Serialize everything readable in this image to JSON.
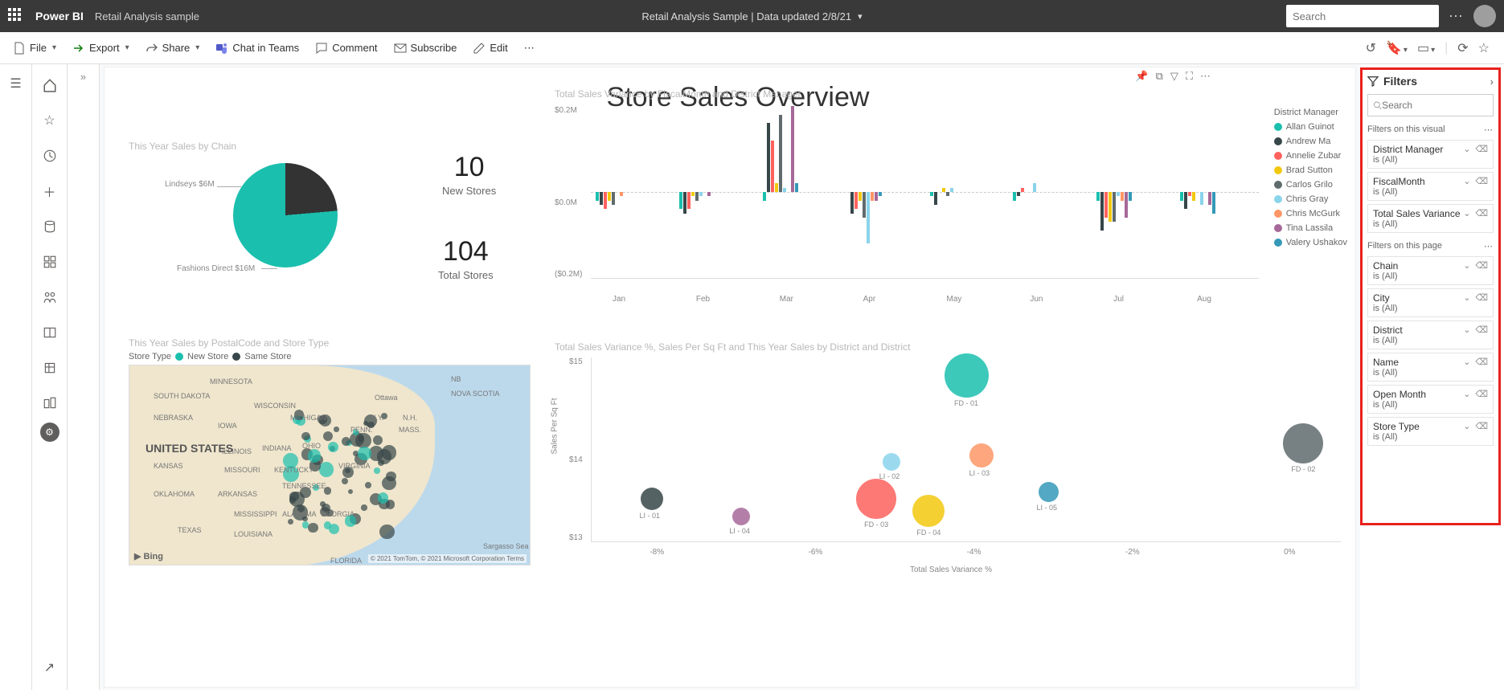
{
  "header": {
    "brand": "Power BI",
    "subtitle": "Retail Analysis sample",
    "center": "Retail Analysis Sample  |  Data updated 2/8/21",
    "search_placeholder": "Search"
  },
  "commands": {
    "file": "File",
    "export": "Export",
    "share": "Share",
    "chat_in_teams": "Chat in Teams",
    "comment": "Comment",
    "subscribe": "Subscribe",
    "edit": "Edit"
  },
  "report": {
    "title": "Store Sales Overview",
    "viz_pie_title": "This Year Sales by Chain",
    "pie_label_a": "Lindseys $6M",
    "pie_label_b": "Fashions Direct $16M",
    "kpi1_val": "10",
    "kpi1_lbl": "New Stores",
    "kpi2_val": "104",
    "kpi2_lbl": "Total Stores",
    "viz_bar_title": "Total Sales Variance by FiscalMonth and District Manager",
    "legend_title": "District Manager",
    "legend_items": [
      {
        "name": "Allan Guinot",
        "color": "#1bbfae"
      },
      {
        "name": "Andrew Ma",
        "color": "#374649"
      },
      {
        "name": "Annelie Zubar",
        "color": "#fd625e"
      },
      {
        "name": "Brad Sutton",
        "color": "#f2c80f"
      },
      {
        "name": "Carlos Grilo",
        "color": "#5f6b6d"
      },
      {
        "name": "Chris Gray",
        "color": "#8ad4eb"
      },
      {
        "name": "Chris McGurk",
        "color": "#fe9666"
      },
      {
        "name": "Tina Lassila",
        "color": "#a66999"
      },
      {
        "name": "Valery Ushakov",
        "color": "#3599b8"
      }
    ],
    "bar_y_top": "$0.2M",
    "bar_y_mid": "$0.0M",
    "bar_y_bot": "($0.2M)",
    "bar_x": [
      "Jan",
      "Feb",
      "Mar",
      "Apr",
      "May",
      "Jun",
      "Jul",
      "Aug"
    ],
    "viz_map_title": "This Year Sales by PostalCode and Store Type",
    "map_legend_label": "Store Type",
    "map_legend_a": "New Store",
    "map_legend_b": "Same Store",
    "map_country": "UNITED STATES",
    "map_bing": "▶ Bing",
    "map_attr": "© 2021 TomTom, © 2021 Microsoft Corporation  Terms",
    "viz_scatter_title": "Total Sales Variance %, Sales Per Sq Ft and This Year Sales by District and District",
    "scatter_y_label": "Sales Per Sq Ft",
    "scatter_x_label": "Total Sales Variance %",
    "scatter_y_ticks": [
      "$15",
      "$14",
      "$13"
    ],
    "scatter_x_ticks": [
      "-8%",
      "-6%",
      "-4%",
      "-2%",
      "0%"
    ],
    "scatter_points": [
      "FD - 01",
      "FD - 02",
      "LI - 03",
      "LI - 02",
      "FD - 03",
      "FD - 04",
      "LI - 05",
      "LI - 01",
      "LI - 04"
    ]
  },
  "filters": {
    "title": "Filters",
    "search_placeholder": "Search",
    "section_visual": "Filters on this visual",
    "section_page": "Filters on this page",
    "is_all": "is (All)",
    "visual_filters": [
      "District Manager",
      "FiscalMonth",
      "Total Sales Variance"
    ],
    "page_filters": [
      "Chain",
      "City",
      "District",
      "Name",
      "Open Month",
      "Store Type"
    ]
  },
  "chart_data": [
    {
      "type": "pie",
      "title": "This Year Sales by Chain",
      "series": [
        {
          "name": "Lindseys",
          "value": 6,
          "unit": "$M",
          "color": "#374649"
        },
        {
          "name": "Fashions Direct",
          "value": 16,
          "unit": "$M",
          "color": "#1bbfae"
        }
      ]
    },
    {
      "type": "bar",
      "title": "Total Sales Variance by FiscalMonth and District Manager",
      "ylabel": "Total Sales Variance",
      "ylim": [
        -0.2,
        0.2
      ],
      "yunit": "$M",
      "categories": [
        "Jan",
        "Feb",
        "Mar",
        "Apr",
        "May",
        "Jun",
        "Jul",
        "Aug"
      ],
      "series": [
        {
          "name": "Allan Guinot",
          "color": "#1bbfae",
          "values": [
            -0.02,
            -0.04,
            -0.02,
            0.0,
            -0.01,
            -0.02,
            -0.02,
            -0.02
          ]
        },
        {
          "name": "Andrew Ma",
          "color": "#374649",
          "values": [
            -0.03,
            -0.05,
            0.16,
            -0.05,
            -0.03,
            -0.01,
            -0.09,
            -0.04
          ]
        },
        {
          "name": "Annelie Zubar",
          "color": "#fd625e",
          "values": [
            -0.04,
            -0.04,
            0.12,
            -0.04,
            0.0,
            0.01,
            -0.06,
            -0.01
          ]
        },
        {
          "name": "Brad Sutton",
          "color": "#f2c80f",
          "values": [
            -0.02,
            -0.01,
            0.02,
            -0.02,
            0.01,
            0.0,
            -0.07,
            -0.02
          ]
        },
        {
          "name": "Carlos Grilo",
          "color": "#5f6b6d",
          "values": [
            -0.03,
            -0.02,
            0.18,
            -0.06,
            -0.01,
            0.0,
            -0.07,
            0.0
          ]
        },
        {
          "name": "Chris Gray",
          "color": "#8ad4eb",
          "values": [
            0.0,
            -0.01,
            0.01,
            -0.12,
            0.01,
            0.02,
            -0.01,
            -0.03
          ]
        },
        {
          "name": "Chris McGurk",
          "color": "#fe9666",
          "values": [
            -0.01,
            0.0,
            0.0,
            -0.02,
            0.0,
            0.0,
            -0.02,
            0.0
          ]
        },
        {
          "name": "Tina Lassila",
          "color": "#a66999",
          "values": [
            0.0,
            -0.01,
            0.2,
            -0.02,
            0.0,
            0.0,
            -0.06,
            -0.03
          ]
        },
        {
          "name": "Valery Ushakov",
          "color": "#3599b8",
          "values": [
            0.0,
            0.0,
            0.02,
            -0.01,
            0.0,
            0.0,
            -0.02,
            -0.05
          ]
        }
      ]
    },
    {
      "type": "scatter",
      "title": "Total Sales Variance %, Sales Per Sq Ft and This Year Sales by District and District",
      "xlabel": "Total Sales Variance %",
      "ylabel": "Sales Per Sq Ft",
      "xlim": [
        -9,
        1
      ],
      "ylim": [
        12.5,
        15.5
      ],
      "points": [
        {
          "name": "FD - 01",
          "x": -4.0,
          "y": 15.2,
          "size": 55,
          "color": "#1bbfae"
        },
        {
          "name": "FD - 02",
          "x": 0.5,
          "y": 14.1,
          "size": 50,
          "color": "#5f6b6d"
        },
        {
          "name": "LI - 03",
          "x": -3.8,
          "y": 13.9,
          "size": 30,
          "color": "#fe9666"
        },
        {
          "name": "LI - 02",
          "x": -5.0,
          "y": 13.8,
          "size": 22,
          "color": "#8ad4eb"
        },
        {
          "name": "FD - 03",
          "x": -5.2,
          "y": 13.2,
          "size": 50,
          "color": "#fd625e"
        },
        {
          "name": "FD - 04",
          "x": -4.5,
          "y": 13.0,
          "size": 40,
          "color": "#f2c80f"
        },
        {
          "name": "LI - 05",
          "x": -2.9,
          "y": 13.3,
          "size": 25,
          "color": "#3599b8"
        },
        {
          "name": "LI - 01",
          "x": -8.2,
          "y": 13.2,
          "size": 28,
          "color": "#374649"
        },
        {
          "name": "LI - 04",
          "x": -7.0,
          "y": 12.9,
          "size": 22,
          "color": "#a66999"
        }
      ]
    }
  ]
}
